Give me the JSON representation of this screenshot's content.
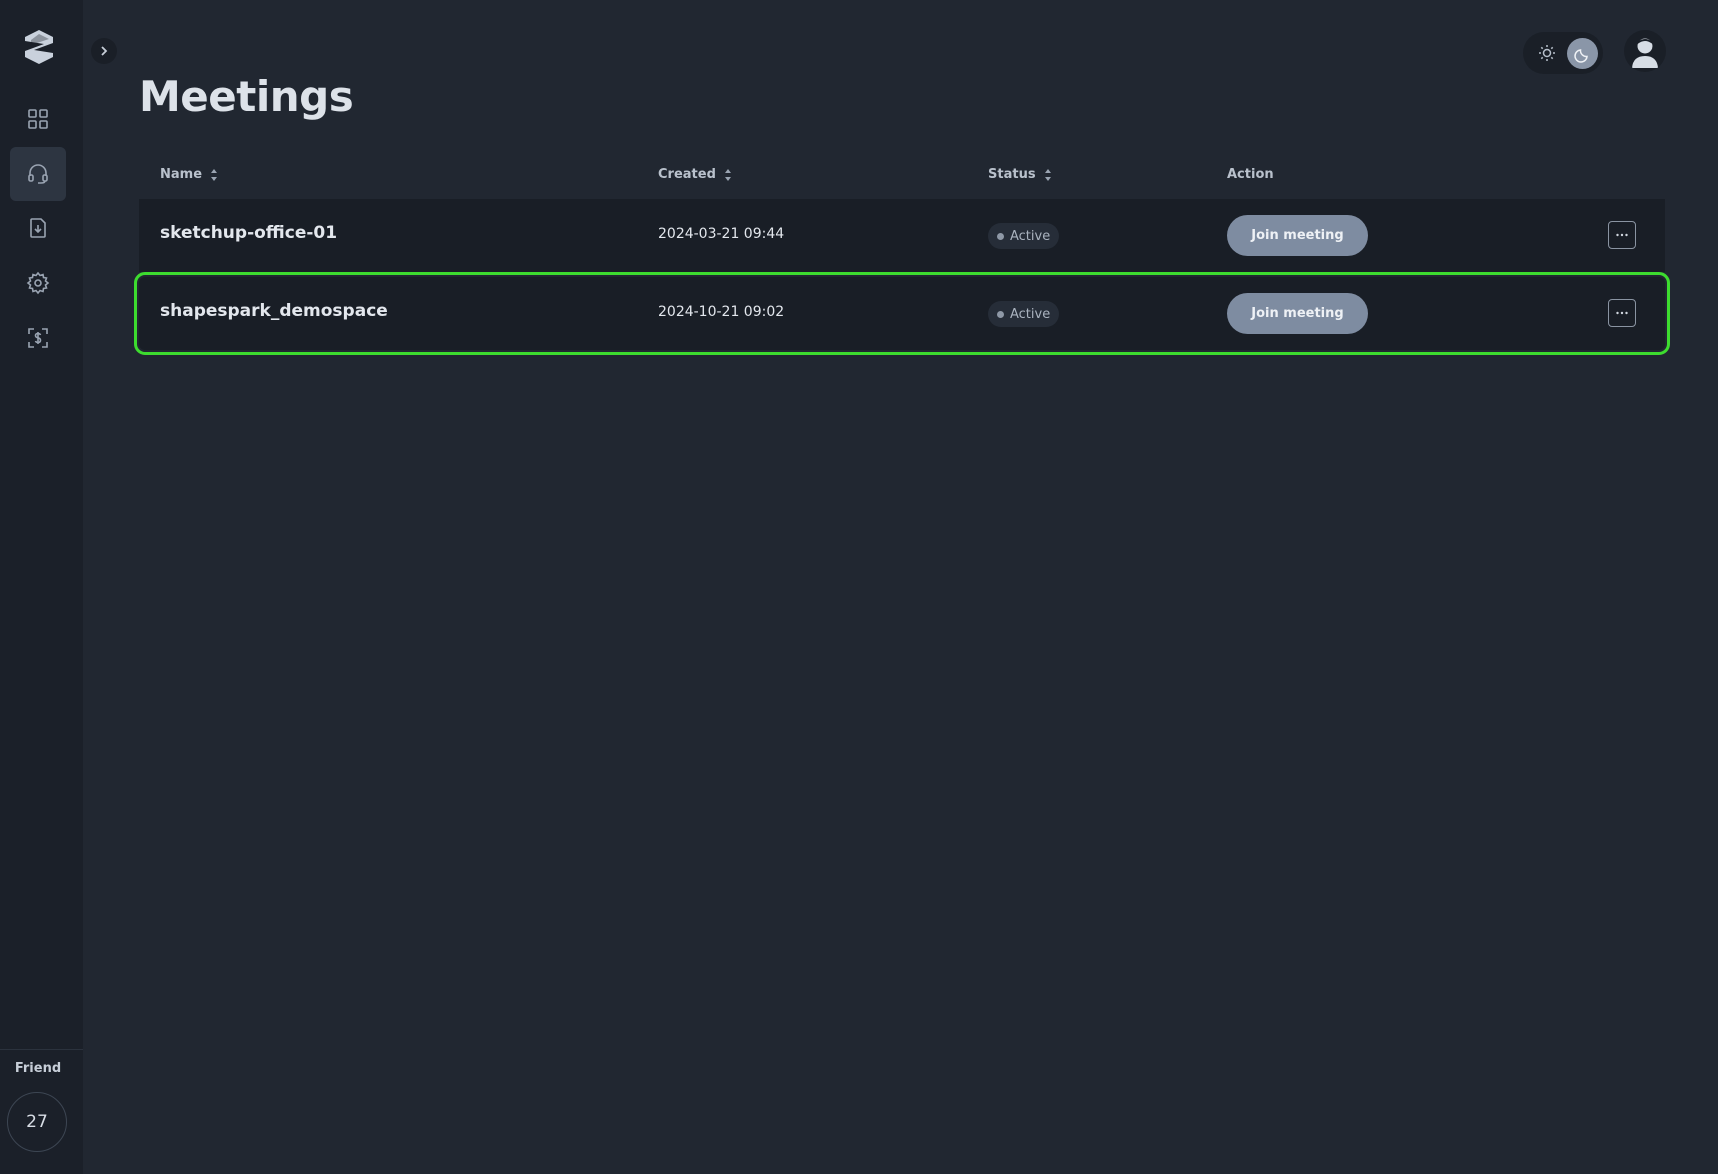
{
  "page": {
    "title": "Meetings"
  },
  "sidebar": {
    "items": [
      {
        "icon": "dashboard-grid-icon"
      },
      {
        "icon": "headset-icon",
        "active": true
      },
      {
        "icon": "download-file-icon"
      },
      {
        "icon": "gear-icon"
      },
      {
        "icon": "billing-dollar-icon"
      }
    ],
    "friend_label": "Friend",
    "friend_count": "27"
  },
  "table": {
    "headers": {
      "name": "Name",
      "created": "Created",
      "status": "Status",
      "action": "Action"
    },
    "rows": [
      {
        "name": "sketchup-office-01",
        "created": "2024-03-21 09:44",
        "status": "Active",
        "action_label": "Join meeting"
      },
      {
        "name": "shapespark_demospace",
        "created": "2024-10-21 09:02",
        "status": "Active",
        "action_label": "Join meeting",
        "highlighted": true
      }
    ]
  },
  "colors": {
    "background": "#212731",
    "sidebar": "#1b2029",
    "row": "#191e26",
    "button": "#7e8ca1",
    "highlight": "#3ddc2f"
  }
}
